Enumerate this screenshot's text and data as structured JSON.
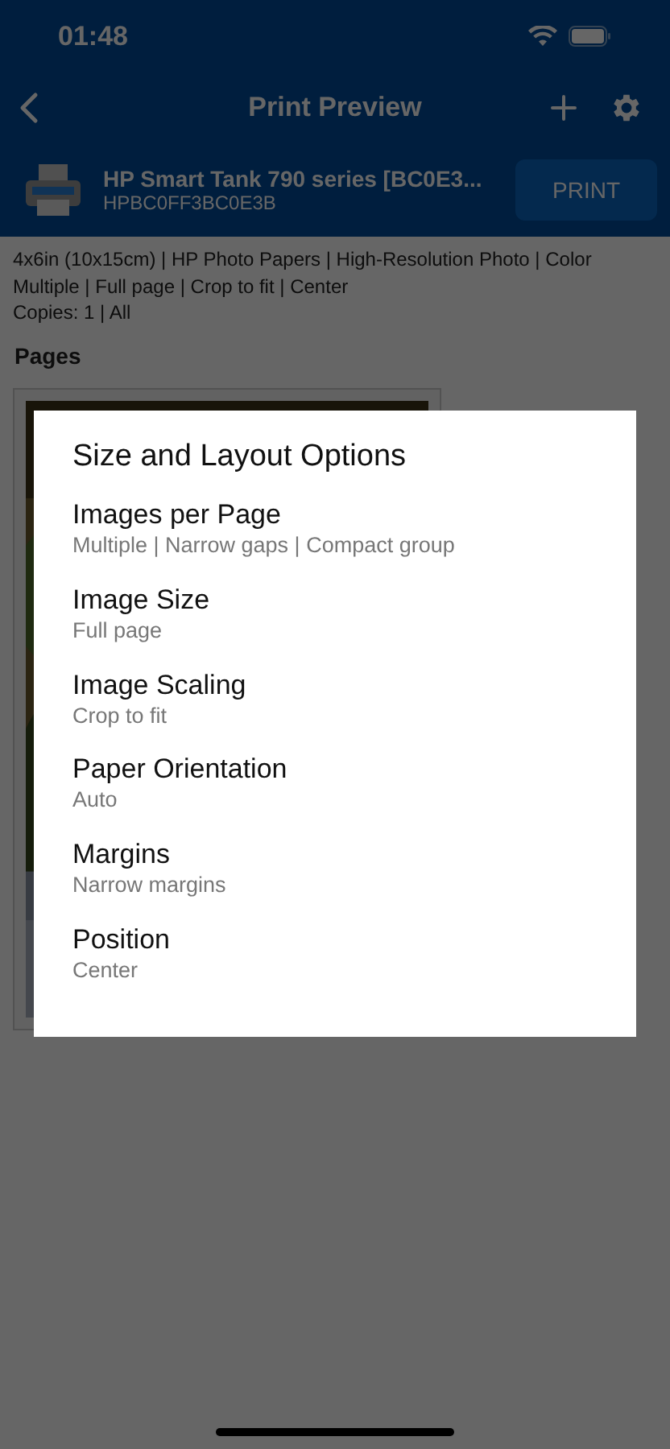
{
  "status_bar": {
    "time": "01:48"
  },
  "nav_bar": {
    "title": "Print Preview"
  },
  "printer": {
    "name": "HP Smart Tank 790 series [BC0E3...",
    "id": "HPBC0FF3BC0E3B",
    "print_button": "PRINT"
  },
  "summary": [
    "4x6in (10x15cm) | HP Photo Papers | High-Resolution Photo | Color",
    "Multiple | Full page | Crop to fit | Center",
    "Copies: 1 | All"
  ],
  "pages_heading": "Pages",
  "dialog": {
    "title": "Size and Layout Options",
    "options": [
      {
        "label": "Images per Page",
        "value": "Multiple | Narrow gaps | Compact group"
      },
      {
        "label": "Image Size",
        "value": "Full page"
      },
      {
        "label": "Image Scaling",
        "value": "Crop to fit"
      },
      {
        "label": "Paper Orientation",
        "value": "Auto"
      },
      {
        "label": "Margins",
        "value": "Narrow margins"
      },
      {
        "label": "Position",
        "value": "Center"
      }
    ]
  }
}
